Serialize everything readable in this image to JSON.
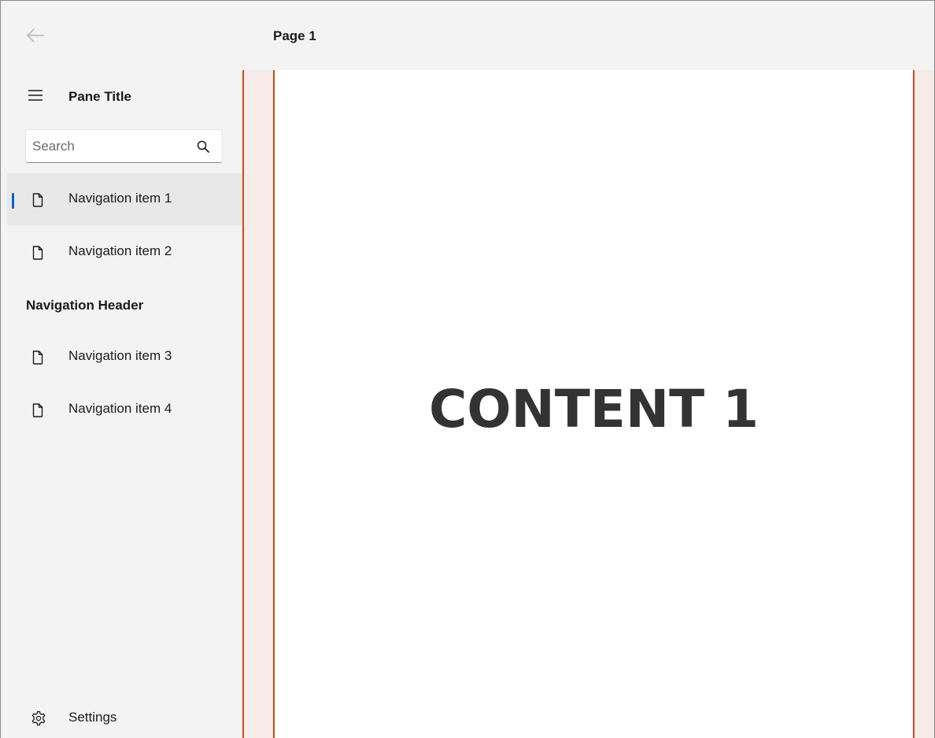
{
  "titlebar": {
    "page_title": "Page 1",
    "back_icon": "arrow-left-icon"
  },
  "pane": {
    "title": "Pane Title",
    "menu_icon": "hamburger-icon",
    "search": {
      "placeholder": "Search",
      "value": "",
      "icon": "search-icon"
    },
    "items": [
      {
        "label": "Navigation item 1",
        "icon": "document-icon",
        "selected": true
      },
      {
        "label": "Navigation item 2",
        "icon": "document-icon",
        "selected": false
      },
      {
        "label": "Navigation item 3",
        "icon": "document-icon",
        "selected": false
      },
      {
        "label": "Navigation item 4",
        "icon": "document-icon",
        "selected": false
      }
    ],
    "header": "Navigation Header",
    "settings": {
      "label": "Settings",
      "icon": "gear-icon"
    }
  },
  "content": {
    "text": "CONTENT 1"
  },
  "colors": {
    "accent": "#0067c0",
    "content_border": "#d2491c",
    "content_margin_bg": "#f6ebe6",
    "pane_bg": "#f3f3f3",
    "selected_bg": "#e8e8e8"
  }
}
